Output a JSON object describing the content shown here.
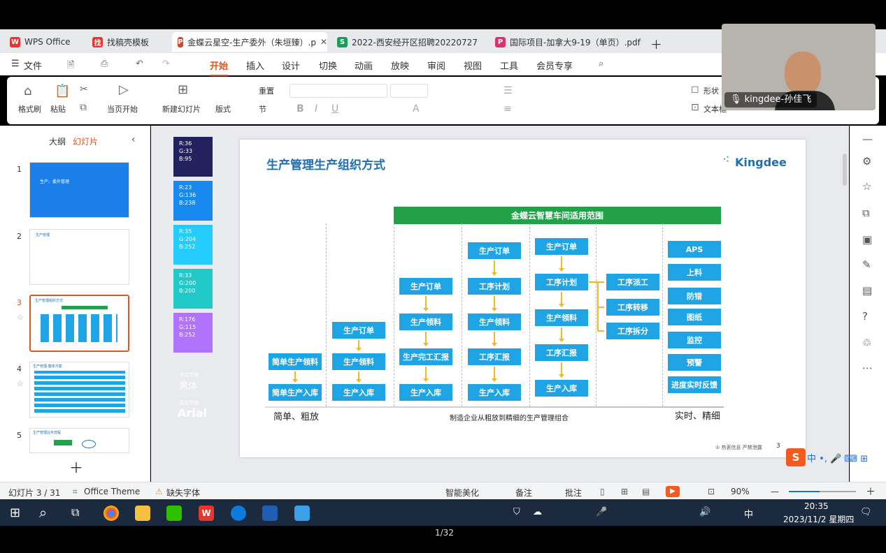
{
  "tabs": [
    {
      "label": "WPS Office",
      "icon": "W",
      "color": "#e8352d"
    },
    {
      "label": "找稿壳模板",
      "icon": "找",
      "color": "#e8352d"
    },
    {
      "label": "金蝶云星空-生产委外（朱垣臻）.p",
      "icon": "P",
      "color": "#d24726"
    },
    {
      "label": "2022-西安经开区招聘20220727",
      "icon": "S",
      "color": "#18a058"
    },
    {
      "label": "国际项目-加拿大9-19（单页）.pdf",
      "icon": "P",
      "color": "#d6336c"
    }
  ],
  "menu": {
    "file": "文件",
    "items": [
      "开始",
      "插入",
      "设计",
      "切换",
      "动画",
      "放映",
      "审阅",
      "视图",
      "工具",
      "会员专享"
    ]
  },
  "ribbon": {
    "format_painter": "格式刷",
    "paste": "粘贴",
    "current_page_start": "当页开始",
    "new_slide": "新建幻灯片",
    "layout": "版式",
    "section": "节",
    "reset": "重置",
    "shape": "形状",
    "textbox": "文本框"
  },
  "panel": {
    "tab_outline": "大纲",
    "tab_slides": "幻灯片",
    "thumb_titles": [
      "生产、委外管理",
      "生产管理",
      "生产管理组织方式",
      "生产管理-整体方案",
      "",
      "生产管理业务流程"
    ]
  },
  "swatches": [
    {
      "text": "R:36 G:33 B:95",
      "color": "#24215f"
    },
    {
      "text": "R:23 G:136 B:238",
      "color": "#1788ee"
    },
    {
      "text": "R:35 G:204 B:252",
      "color": "#23ccfc"
    },
    {
      "text": "R:33 G:200 B:200",
      "color": "#21c8c8"
    },
    {
      "text": "R:176 G:115 B:252",
      "color": "#b073fc"
    }
  ],
  "font_hint": {
    "line1": "中文字体",
    "line2": "黑体",
    "line3": "英文字体",
    "line4": "Arial"
  },
  "slide": {
    "title": "生产管理生产组织方式",
    "logo": "Kingdee",
    "banner": "金蝶云智慧车间适用范围",
    "col1": [
      "简单生产领料",
      "简单生产入库"
    ],
    "col2": [
      "生产订单",
      "生产领料",
      "生产入库"
    ],
    "col3": [
      "生产订单",
      "生产领料",
      "生产完工汇报",
      "生产入库"
    ],
    "col4": [
      "生产订单",
      "工序计划",
      "生产领料",
      "工序汇报",
      "生产入库"
    ],
    "col5": [
      "生产订单",
      "工序计划",
      "生产领料",
      "工序汇报",
      "生产入库"
    ],
    "col6": [
      "工序派工",
      "工序转移",
      "工序拆分"
    ],
    "col7": [
      "APS",
      "上料",
      "防错",
      "图纸",
      "监控",
      "预警",
      "进度实时反馈"
    ],
    "left_label": "简单、粗放",
    "center_label": "制造企业从粗放到精细的生产管理组合",
    "right_label": "实时、精细",
    "footer": "① 热衷信息 严禁泄露",
    "page": "3"
  },
  "webcam": {
    "name": "kingdee-孙佳飞"
  },
  "status": {
    "slide_info": "幻灯片 3 / 31",
    "theme": "Office Theme",
    "missing_font": "缺失字体",
    "beautify": "智能美化",
    "notes": "备注",
    "comments": "批注",
    "zoom": "90%"
  },
  "taskbar": {
    "time": "20:35",
    "date": "2023/11/2 星期四",
    "ime": "中"
  },
  "page_counter": "1/32"
}
